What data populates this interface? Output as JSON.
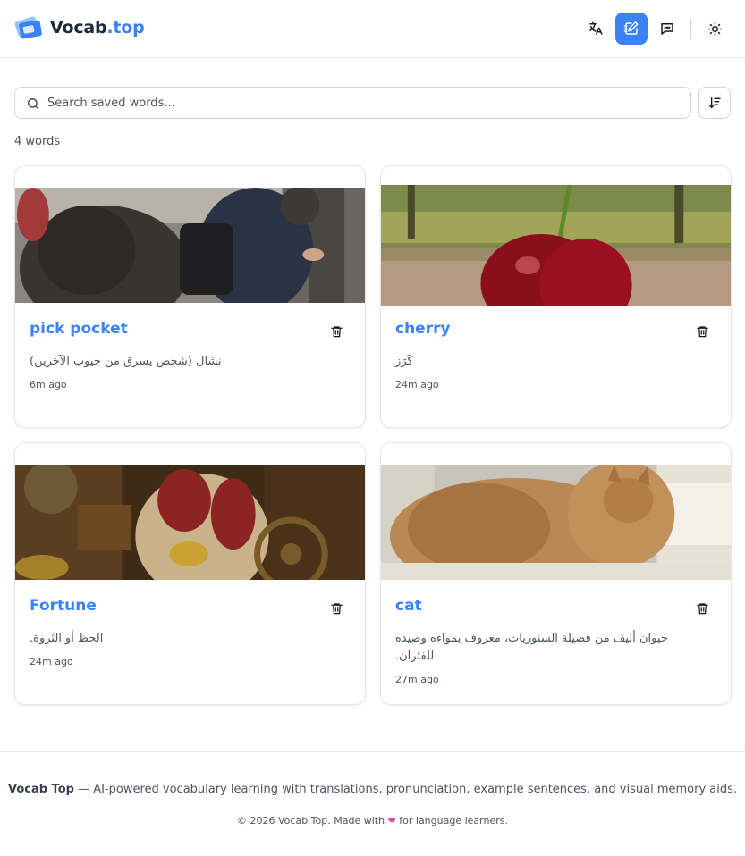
{
  "header": {
    "brand_main": "Vocab",
    "brand_accent": ".top",
    "buttons": [
      {
        "icon": "translate-icon",
        "active": false
      },
      {
        "icon": "notebook-edit-icon",
        "active": true
      },
      {
        "icon": "chat-icon",
        "active": false
      },
      {
        "icon": "sun-icon",
        "active": false
      }
    ]
  },
  "search": {
    "placeholder": "Search saved words...",
    "value": ""
  },
  "count_label": "4 words",
  "cards": [
    {
      "word": "pick pocket",
      "meaning": "نشال (شخص يسرق من جيوب الآخرين)",
      "time": "6m ago",
      "image": "crowd-photo"
    },
    {
      "word": "cherry",
      "meaning": "كَرَز",
      "time": "24m ago",
      "image": "cherry-photo"
    },
    {
      "word": "Fortune",
      "meaning": "الحظ أو الثروة.",
      "time": "24m ago",
      "image": "treasure-photo"
    },
    {
      "word": "cat",
      "meaning": "حيوان أليف من فصيلة السنوريات، معروف بمواءه وصيده للفئران.",
      "time": "27m ago",
      "image": "cat-photo"
    }
  ],
  "footer": {
    "brand": "Vocab Top",
    "tagline": " — AI-powered vocabulary learning with translations, pronunciation, example sentences, and visual memory aids.",
    "copy_before": "© 2026 Vocab Top. Made with ",
    "copy_after": " for language learners."
  },
  "colors": {
    "accent": "#3b82f6",
    "heart": "#ec4899"
  }
}
